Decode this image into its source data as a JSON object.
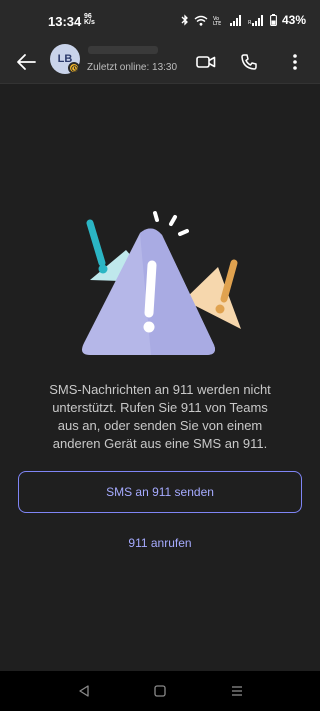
{
  "status_bar": {
    "time": "13:34",
    "network_small_top": "96",
    "network_small_bottom": "K/s",
    "battery": "43%"
  },
  "header": {
    "avatar_initials": "LB",
    "last_online": "Zuletzt online: 13:30",
    "icons": [
      "back-arrow-icon",
      "video-call-icon",
      "phone-call-icon",
      "more-options-icon"
    ]
  },
  "main": {
    "message": "SMS-Nachrichten an 911 werden nicht unterstützt. Rufen Sie 911 von Teams aus an, oder senden Sie von einem anderen Gerät aus eine SMS an 911.",
    "primary_button": "SMS an 911 senden",
    "secondary_link": "911 anrufen"
  },
  "colors": {
    "background": "#1f1f1f",
    "header": "#292929",
    "accent": "#a6abff",
    "border_accent": "#7f85f5",
    "presence_away": "#f0b429"
  },
  "nav_bar": {
    "icons": [
      "back-triangle-icon",
      "home-square-icon",
      "recents-menu-icon"
    ]
  }
}
